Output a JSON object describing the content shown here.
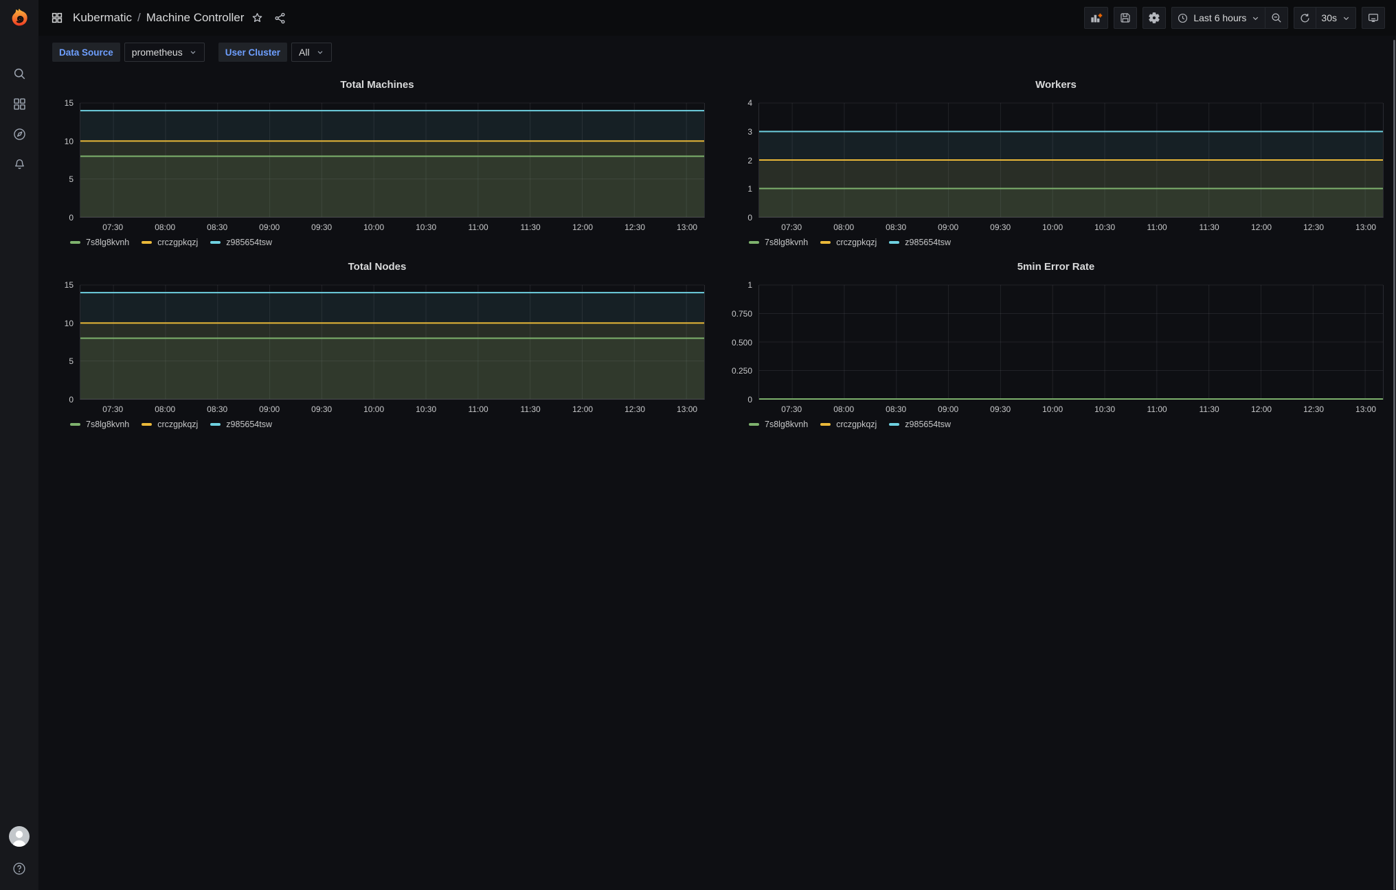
{
  "topnav": {
    "breadcrumb": {
      "folder": "Kubermatic",
      "separator": "/",
      "title": "Machine Controller"
    },
    "time_range_label": "Last 6 hours",
    "refresh_interval": "30s"
  },
  "variables": [
    {
      "label": "Data Source",
      "value": "prometheus"
    },
    {
      "label": "User Cluster",
      "value": "All"
    }
  ],
  "icons": {
    "sidebar": [
      "grafana-logo",
      "search",
      "dashboards-grid",
      "explore-compass",
      "alerting-bell"
    ],
    "sidebar_bottom": [
      "user-avatar",
      "help-circle"
    ],
    "breadcrumb": [
      "apps-grid",
      "star",
      "share"
    ],
    "toolbar": [
      "add-panel",
      "save",
      "settings-gear",
      "clock",
      "chevron-down",
      "zoom-out",
      "refresh",
      "kiosk-monitor"
    ]
  },
  "colors": {
    "green": "#7EB26D",
    "yellow": "#EAB839",
    "blue": "#6ED0E0",
    "accent_blue": "#6e9fff",
    "orange_plus": "#F46800",
    "page_bg": "#0e0f13",
    "sidebar_bg": "#17181c",
    "navbar_bg": "#0b0c0e"
  },
  "chart_data": [
    {
      "type": "line",
      "title": "Total Machines",
      "x_ticks": [
        "07:30",
        "08:00",
        "08:30",
        "09:00",
        "09:30",
        "10:00",
        "10:30",
        "11:00",
        "11:30",
        "12:00",
        "12:30",
        "13:00"
      ],
      "x_start_frac": 0.053,
      "x_step_frac": 0.0835,
      "y_max": 15,
      "y_ticks": [
        {
          "label": "0",
          "value": 0
        },
        {
          "label": "5",
          "value": 5
        },
        {
          "label": "10",
          "value": 10
        },
        {
          "label": "15",
          "value": 15
        }
      ],
      "series": [
        {
          "name": "7s8lg8kvnh",
          "color": "#7EB26D",
          "value": 8
        },
        {
          "name": "crczgpkqzj",
          "color": "#EAB839",
          "value": 10
        },
        {
          "name": "z985654tsw",
          "color": "#6ED0E0",
          "value": 14
        }
      ],
      "fill_opacity": 0.09,
      "legend_position": "bottom-left",
      "grid": true
    },
    {
      "type": "line",
      "title": "Workers",
      "x_ticks": [
        "07:30",
        "08:00",
        "08:30",
        "09:00",
        "09:30",
        "10:00",
        "10:30",
        "11:00",
        "11:30",
        "12:00",
        "12:30",
        "13:00"
      ],
      "x_start_frac": 0.053,
      "x_step_frac": 0.0835,
      "y_max": 4,
      "y_ticks": [
        {
          "label": "0",
          "value": 0
        },
        {
          "label": "1",
          "value": 1
        },
        {
          "label": "2",
          "value": 2
        },
        {
          "label": "3",
          "value": 3
        },
        {
          "label": "4",
          "value": 4
        }
      ],
      "series": [
        {
          "name": "7s8lg8kvnh",
          "color": "#7EB26D",
          "value": 1
        },
        {
          "name": "crczgpkqzj",
          "color": "#EAB839",
          "value": 2
        },
        {
          "name": "z985654tsw",
          "color": "#6ED0E0",
          "value": 3
        }
      ],
      "fill_opacity": 0.09,
      "legend_position": "bottom-left",
      "grid": true
    },
    {
      "type": "line",
      "title": "Total Nodes",
      "x_ticks": [
        "07:30",
        "08:00",
        "08:30",
        "09:00",
        "09:30",
        "10:00",
        "10:30",
        "11:00",
        "11:30",
        "12:00",
        "12:30",
        "13:00"
      ],
      "x_start_frac": 0.053,
      "x_step_frac": 0.0835,
      "y_max": 15,
      "y_ticks": [
        {
          "label": "0",
          "value": 0
        },
        {
          "label": "5",
          "value": 5
        },
        {
          "label": "10",
          "value": 10
        },
        {
          "label": "15",
          "value": 15
        }
      ],
      "series": [
        {
          "name": "7s8lg8kvnh",
          "color": "#7EB26D",
          "value": 8
        },
        {
          "name": "crczgpkqzj",
          "color": "#EAB839",
          "value": 10
        },
        {
          "name": "z985654tsw",
          "color": "#6ED0E0",
          "value": 14
        }
      ],
      "fill_opacity": 0.09,
      "legend_position": "bottom-left",
      "grid": true
    },
    {
      "type": "line",
      "title": "5min Error Rate",
      "x_ticks": [
        "07:30",
        "08:00",
        "08:30",
        "09:00",
        "09:30",
        "10:00",
        "10:30",
        "11:00",
        "11:30",
        "12:00",
        "12:30",
        "13:00"
      ],
      "x_start_frac": 0.053,
      "x_step_frac": 0.0835,
      "y_max": 1,
      "y_ticks": [
        {
          "label": "0",
          "value": 0
        },
        {
          "label": "0.250",
          "value": 0.25
        },
        {
          "label": "0.500",
          "value": 0.5
        },
        {
          "label": "0.750",
          "value": 0.75
        },
        {
          "label": "1",
          "value": 1
        }
      ],
      "series": [
        {
          "name": "7s8lg8kvnh",
          "color": "#7EB26D",
          "value": 0
        },
        {
          "name": "crczgpkqzj",
          "color": "#EAB839",
          "value": 0
        },
        {
          "name": "z985654tsw",
          "color": "#6ED0E0",
          "value": 0
        }
      ],
      "fill_opacity": 0.09,
      "legend_position": "bottom-left",
      "grid": true
    }
  ]
}
